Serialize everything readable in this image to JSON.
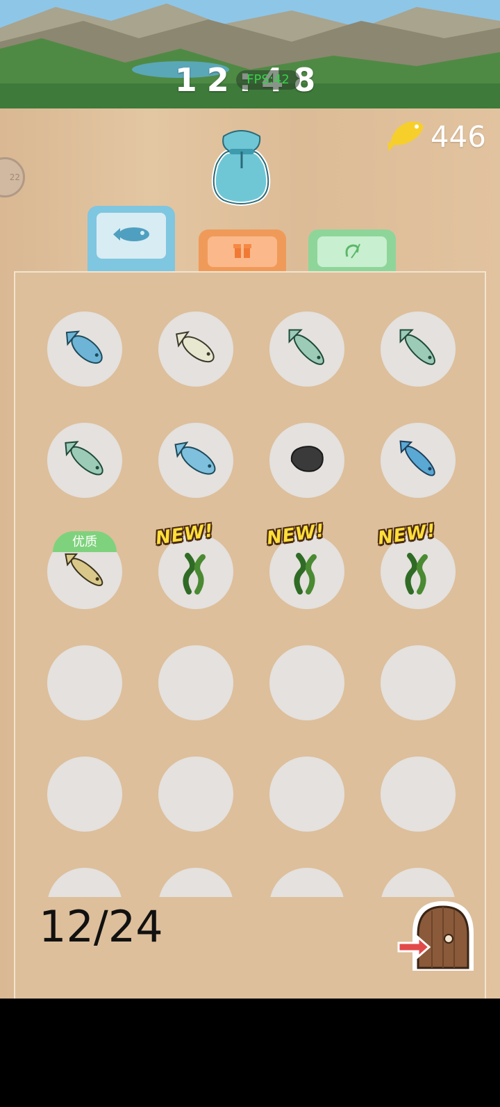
{
  "status_bar": {
    "clock": "12:48",
    "fps": "FPS:42"
  },
  "header": {
    "coins": "446",
    "coin_icon": "yellow-fish-icon",
    "bag_icon": "bag-icon",
    "side_badge": "22"
  },
  "tabs": [
    {
      "name": "fish",
      "icon": "fish-icon",
      "color": "#7fc6e0"
    },
    {
      "name": "gift",
      "icon": "gift-icon",
      "color": "#f09a5a"
    },
    {
      "name": "tool",
      "icon": "hook-icon",
      "color": "#8ed59a"
    }
  ],
  "inventory": {
    "count_label": "12/24",
    "items": [
      {
        "icon": "blue-fish-icon",
        "badge": ""
      },
      {
        "icon": "white-fish-icon",
        "badge": ""
      },
      {
        "icon": "green-fish-icon",
        "badge": ""
      },
      {
        "icon": "green-fish-icon",
        "badge": ""
      },
      {
        "icon": "green-fish-icon",
        "badge": ""
      },
      {
        "icon": "blue-spotted-fish-icon",
        "badge": ""
      },
      {
        "icon": "black-rock-icon",
        "badge": ""
      },
      {
        "icon": "slim-blue-fish-icon",
        "badge": ""
      },
      {
        "icon": "yellow-fish-icon",
        "badge": "优质"
      },
      {
        "icon": "seaweed-icon",
        "badge": "NEW!"
      },
      {
        "icon": "seaweed-icon",
        "badge": "NEW!"
      },
      {
        "icon": "seaweed-icon",
        "badge": "NEW!"
      }
    ]
  },
  "exit_icon": "door-exit-icon"
}
